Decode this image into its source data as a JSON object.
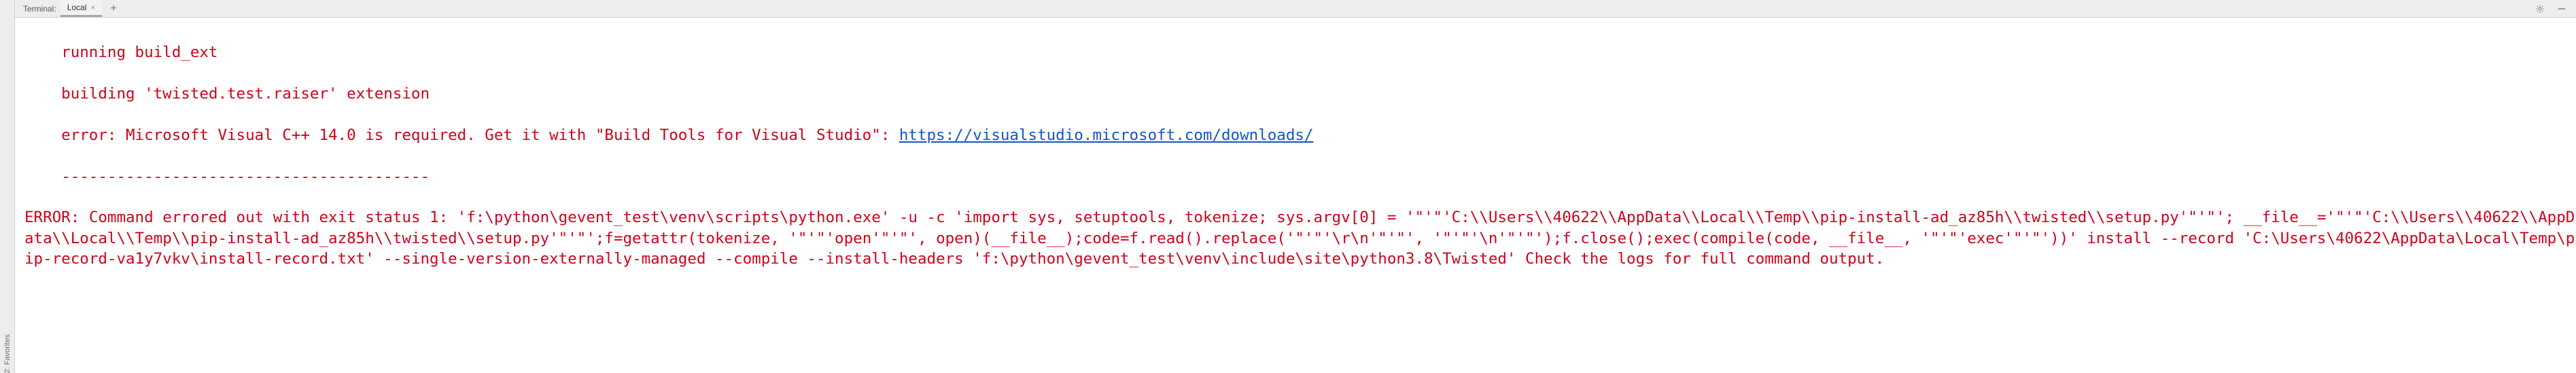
{
  "sidebar": {
    "favorites_label": "2: Favorites"
  },
  "header": {
    "title": "Terminal:",
    "tabs": [
      {
        "label": "Local",
        "active": true
      }
    ],
    "add_tab": "+",
    "gear_icon": "gear",
    "minimize_icon": "minimize"
  },
  "terminal": {
    "lines_indented": [
      "running build_ext",
      "building 'twisted.test.raiser' extension"
    ],
    "error_line_prefix": "error: Microsoft Visual C++ 14.0 is required. Get it with \"Build Tools for Visual Studio\": ",
    "error_line_link": "https://visualstudio.microsoft.com/downloads/",
    "dashes": "----------------------------------------",
    "error_block": "ERROR: Command errored out with exit status 1: 'f:\\python\\gevent_test\\venv\\scripts\\python.exe' -u -c 'import sys, setuptools, tokenize; sys.argv[0] = '\"'\"'C:\\\\Users\\\\40622\\\\AppData\\\\Local\\\\Temp\\\\pip-install-ad_az85h\\\\twisted\\\\setup.py'\"'\"'; __file__='\"'\"'C:\\\\Users\\\\40622\\\\AppData\\\\Local\\\\Temp\\\\pip-install-ad_az85h\\\\twisted\\\\setup.py'\"'\"';f=getattr(tokenize, '\"'\"'open'\"'\"', open)(__file__);code=f.read().replace('\"'\"'\\r\\n'\"'\"', '\"'\"'\\n'\"'\"');f.close();exec(compile(code, __file__, '\"'\"'exec'\"'\"'))' install --record 'C:\\Users\\40622\\AppData\\Local\\Temp\\pip-record-va1y7vkv\\install-record.txt' --single-version-externally-managed --compile --install-headers 'f:\\python\\gevent_test\\venv\\include\\site\\python3.8\\Twisted' Check the logs for full command output."
  }
}
